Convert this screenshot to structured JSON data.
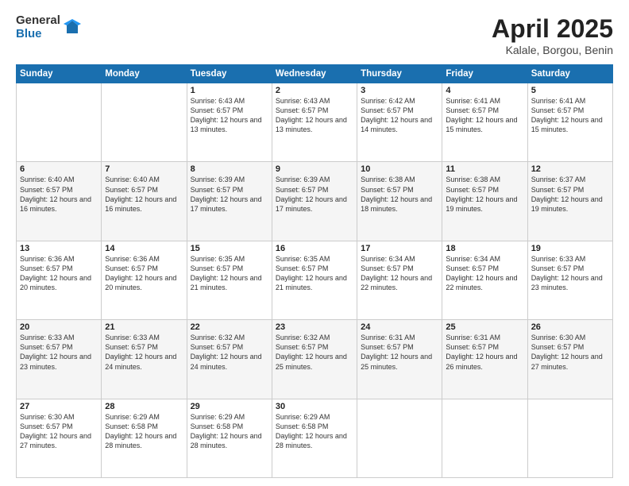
{
  "header": {
    "logo_general": "General",
    "logo_blue": "Blue",
    "month_title": "April 2025",
    "location": "Kalale, Borgou, Benin"
  },
  "days_of_week": [
    "Sunday",
    "Monday",
    "Tuesday",
    "Wednesday",
    "Thursday",
    "Friday",
    "Saturday"
  ],
  "weeks": [
    [
      {
        "day": "",
        "info": ""
      },
      {
        "day": "",
        "info": ""
      },
      {
        "day": "1",
        "info": "Sunrise: 6:43 AM\nSunset: 6:57 PM\nDaylight: 12 hours and 13 minutes."
      },
      {
        "day": "2",
        "info": "Sunrise: 6:43 AM\nSunset: 6:57 PM\nDaylight: 12 hours and 13 minutes."
      },
      {
        "day": "3",
        "info": "Sunrise: 6:42 AM\nSunset: 6:57 PM\nDaylight: 12 hours and 14 minutes."
      },
      {
        "day": "4",
        "info": "Sunrise: 6:41 AM\nSunset: 6:57 PM\nDaylight: 12 hours and 15 minutes."
      },
      {
        "day": "5",
        "info": "Sunrise: 6:41 AM\nSunset: 6:57 PM\nDaylight: 12 hours and 15 minutes."
      }
    ],
    [
      {
        "day": "6",
        "info": "Sunrise: 6:40 AM\nSunset: 6:57 PM\nDaylight: 12 hours and 16 minutes."
      },
      {
        "day": "7",
        "info": "Sunrise: 6:40 AM\nSunset: 6:57 PM\nDaylight: 12 hours and 16 minutes."
      },
      {
        "day": "8",
        "info": "Sunrise: 6:39 AM\nSunset: 6:57 PM\nDaylight: 12 hours and 17 minutes."
      },
      {
        "day": "9",
        "info": "Sunrise: 6:39 AM\nSunset: 6:57 PM\nDaylight: 12 hours and 17 minutes."
      },
      {
        "day": "10",
        "info": "Sunrise: 6:38 AM\nSunset: 6:57 PM\nDaylight: 12 hours and 18 minutes."
      },
      {
        "day": "11",
        "info": "Sunrise: 6:38 AM\nSunset: 6:57 PM\nDaylight: 12 hours and 19 minutes."
      },
      {
        "day": "12",
        "info": "Sunrise: 6:37 AM\nSunset: 6:57 PM\nDaylight: 12 hours and 19 minutes."
      }
    ],
    [
      {
        "day": "13",
        "info": "Sunrise: 6:36 AM\nSunset: 6:57 PM\nDaylight: 12 hours and 20 minutes."
      },
      {
        "day": "14",
        "info": "Sunrise: 6:36 AM\nSunset: 6:57 PM\nDaylight: 12 hours and 20 minutes."
      },
      {
        "day": "15",
        "info": "Sunrise: 6:35 AM\nSunset: 6:57 PM\nDaylight: 12 hours and 21 minutes."
      },
      {
        "day": "16",
        "info": "Sunrise: 6:35 AM\nSunset: 6:57 PM\nDaylight: 12 hours and 21 minutes."
      },
      {
        "day": "17",
        "info": "Sunrise: 6:34 AM\nSunset: 6:57 PM\nDaylight: 12 hours and 22 minutes."
      },
      {
        "day": "18",
        "info": "Sunrise: 6:34 AM\nSunset: 6:57 PM\nDaylight: 12 hours and 22 minutes."
      },
      {
        "day": "19",
        "info": "Sunrise: 6:33 AM\nSunset: 6:57 PM\nDaylight: 12 hours and 23 minutes."
      }
    ],
    [
      {
        "day": "20",
        "info": "Sunrise: 6:33 AM\nSunset: 6:57 PM\nDaylight: 12 hours and 23 minutes."
      },
      {
        "day": "21",
        "info": "Sunrise: 6:33 AM\nSunset: 6:57 PM\nDaylight: 12 hours and 24 minutes."
      },
      {
        "day": "22",
        "info": "Sunrise: 6:32 AM\nSunset: 6:57 PM\nDaylight: 12 hours and 24 minutes."
      },
      {
        "day": "23",
        "info": "Sunrise: 6:32 AM\nSunset: 6:57 PM\nDaylight: 12 hours and 25 minutes."
      },
      {
        "day": "24",
        "info": "Sunrise: 6:31 AM\nSunset: 6:57 PM\nDaylight: 12 hours and 25 minutes."
      },
      {
        "day": "25",
        "info": "Sunrise: 6:31 AM\nSunset: 6:57 PM\nDaylight: 12 hours and 26 minutes."
      },
      {
        "day": "26",
        "info": "Sunrise: 6:30 AM\nSunset: 6:57 PM\nDaylight: 12 hours and 27 minutes."
      }
    ],
    [
      {
        "day": "27",
        "info": "Sunrise: 6:30 AM\nSunset: 6:57 PM\nDaylight: 12 hours and 27 minutes."
      },
      {
        "day": "28",
        "info": "Sunrise: 6:29 AM\nSunset: 6:58 PM\nDaylight: 12 hours and 28 minutes."
      },
      {
        "day": "29",
        "info": "Sunrise: 6:29 AM\nSunset: 6:58 PM\nDaylight: 12 hours and 28 minutes."
      },
      {
        "day": "30",
        "info": "Sunrise: 6:29 AM\nSunset: 6:58 PM\nDaylight: 12 hours and 28 minutes."
      },
      {
        "day": "",
        "info": ""
      },
      {
        "day": "",
        "info": ""
      },
      {
        "day": "",
        "info": ""
      }
    ]
  ]
}
